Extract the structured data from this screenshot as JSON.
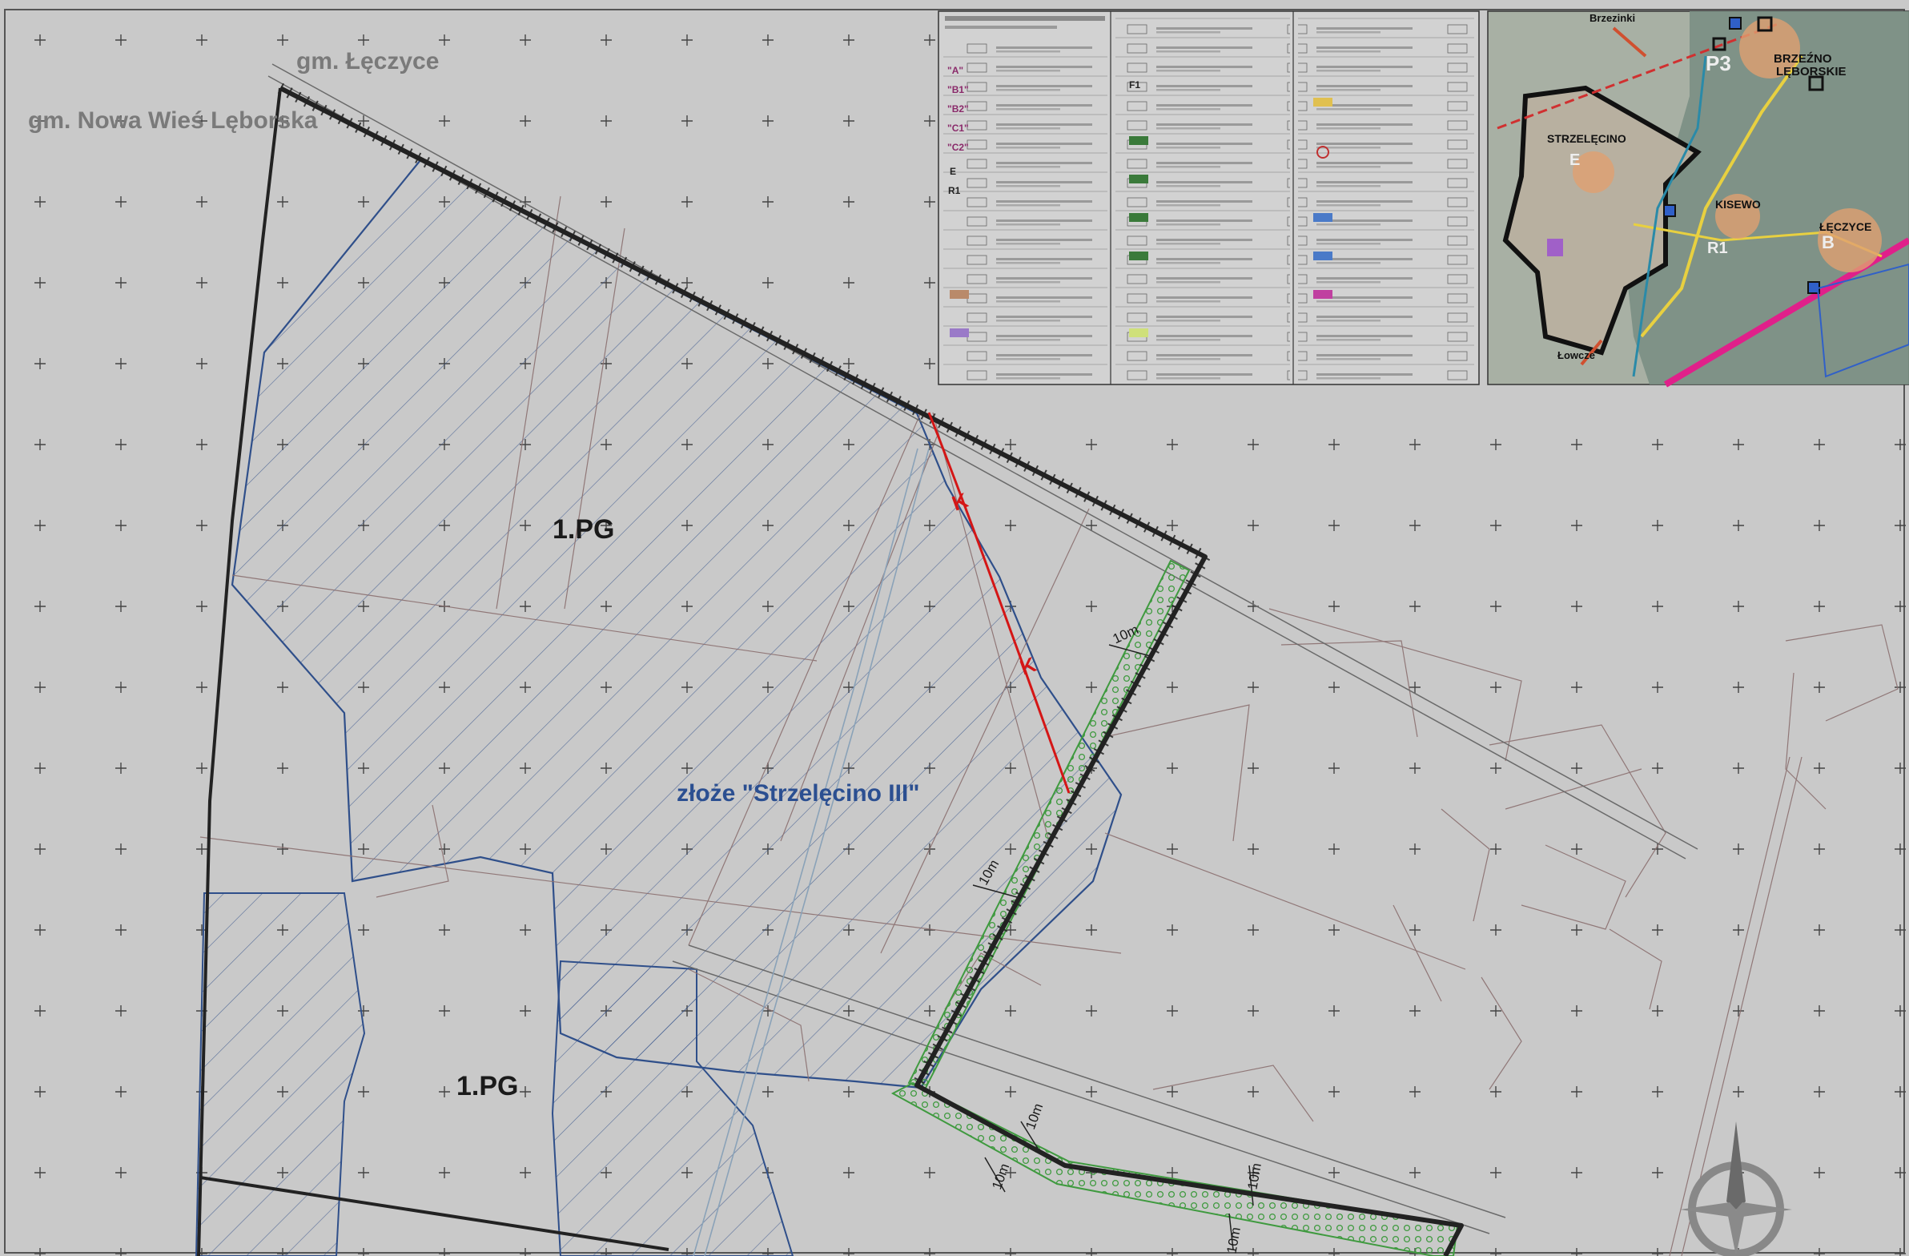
{
  "map": {
    "labels": {
      "gmina_leczyce": "gm. Łęczyce",
      "gmina_nowa_wies": "gm. Nowa Wieś Lęborska",
      "zone_pg_upper": "1.PG",
      "zone_pg_lower": "1.PG",
      "deposit": "złoże \"Strzelęcino III\"",
      "cable_marker_1": "K",
      "cable_marker_2": "K",
      "buffer_a": "10m",
      "buffer_b": "10m",
      "buffer_c": "10m",
      "buffer_d": "10m",
      "buffer_e": "10m",
      "buffer_f": "10m"
    },
    "inset": {
      "brzezinki": "Brzezinki",
      "p3": "P3",
      "brzezno": "BRZEŹNO",
      "leborskie": "LĘBORSKIE",
      "strzelecino": "STRZELĘCINO",
      "e_marker": "E",
      "kisewo": "KISEWO",
      "r1": "R1",
      "leczyce": "ŁĘCZYCE",
      "b_marker": "B",
      "lowcze": "Łowcze"
    },
    "legend_codes": {
      "a": "\"A\"",
      "b1": "\"B1\"",
      "b2": "\"B2\"",
      "c1": "\"C1\"",
      "c2": "\"C2\"",
      "e": "E",
      "r1": "R1",
      "f1": "F1"
    },
    "colors": {
      "background": "#c9c9c9",
      "boundary": "#222222",
      "deposit_outline": "#2f4f8a",
      "deposit_label": "#2b4f91",
      "cable": "#d41616",
      "buffer_green": "#3f9a3f",
      "parcel_line": "#8a6f6f",
      "label_grey": "#7a7a7a"
    }
  }
}
